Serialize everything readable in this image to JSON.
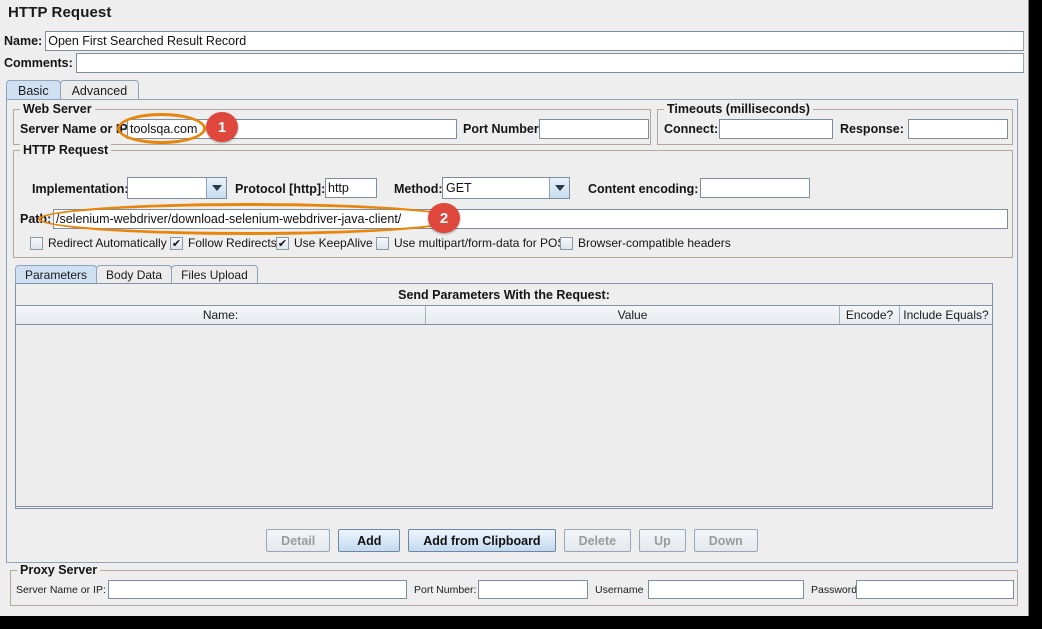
{
  "title": "HTTP Request",
  "header": {
    "name_label": "Name:",
    "name_value": "Open First Searched Result Record",
    "comments_label": "Comments:",
    "comments_value": ""
  },
  "tabs": [
    {
      "label": "Basic",
      "selected": true
    },
    {
      "label": "Advanced",
      "selected": false
    }
  ],
  "web_server": {
    "group_title": "Web Server",
    "server_label": "Server Name or IP:",
    "server_value": "toolsqa.com",
    "port_label": "Port Number:",
    "port_value": ""
  },
  "timeouts": {
    "group_title": "Timeouts (milliseconds)",
    "connect_label": "Connect:",
    "connect_value": "",
    "response_label": "Response:",
    "response_value": ""
  },
  "http_request": {
    "group_title": "HTTP Request",
    "implementation_label": "Implementation:",
    "implementation_value": "",
    "protocol_label": "Protocol [http]:",
    "protocol_value": "http",
    "method_label": "Method:",
    "method_value": "GET",
    "content_encoding_label": "Content encoding:",
    "content_encoding_value": "",
    "path_label": "Path:",
    "path_value": "/selenium-webdriver/download-selenium-webdriver-java-client/",
    "checkboxes": [
      {
        "label": "Redirect Automatically",
        "checked": false,
        "mark": ""
      },
      {
        "label": "Follow Redirects",
        "checked": true,
        "mark": "✔"
      },
      {
        "label": "Use KeepAlive",
        "checked": true,
        "mark": "✔"
      },
      {
        "label": "Use multipart/form-data for POST",
        "checked": false,
        "mark": ""
      },
      {
        "label": "Browser-compatible headers",
        "checked": false,
        "mark": ""
      }
    ]
  },
  "parameters_panel": {
    "tabs": [
      {
        "label": "Parameters",
        "selected": true
      },
      {
        "label": "Body Data",
        "selected": false
      },
      {
        "label": "Files Upload",
        "selected": false
      }
    ],
    "table_caption": "Send Parameters With the Request:",
    "columns": [
      "Name:",
      "Value",
      "Encode?",
      "Include Equals?"
    ],
    "rows": [],
    "buttons": [
      {
        "label": "Detail",
        "enabled": false
      },
      {
        "label": "Add",
        "enabled": true
      },
      {
        "label": "Add from Clipboard",
        "enabled": true
      },
      {
        "label": "Delete",
        "enabled": false
      },
      {
        "label": "Up",
        "enabled": false
      },
      {
        "label": "Down",
        "enabled": false
      }
    ]
  },
  "proxy_server": {
    "group_title": "Proxy Server",
    "server_label": "Server Name or IP:",
    "server_value": "",
    "port_label": "Port Number:",
    "port_value": "",
    "username_label": "Username",
    "username_value": "",
    "password_label": "Password",
    "password_value": ""
  },
  "annotations": {
    "badge_1": "1",
    "badge_2": "2",
    "highlight_color": "#e8860c",
    "badge_color": "#e0473c"
  }
}
